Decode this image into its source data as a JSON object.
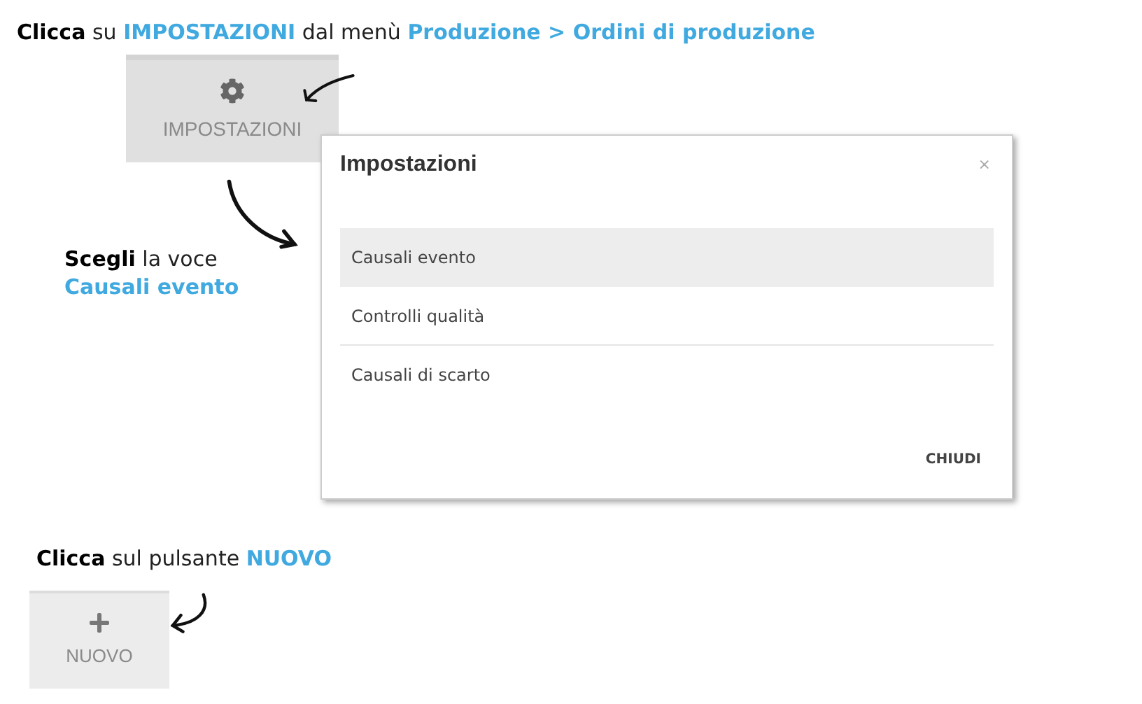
{
  "instructions": [
    {
      "lines": [
        [
          {
            "text": "Clicca",
            "kind": "strong"
          },
          {
            "text": " su ",
            "kind": "plain"
          },
          {
            "text": "IMPOSTAZIONI",
            "kind": "highlight"
          },
          {
            "text": " dal menù ",
            "kind": "plain"
          },
          {
            "text": "Produzione > Ordini di produzione",
            "kind": "highlight"
          }
        ]
      ]
    },
    {
      "lines": [
        [
          {
            "text": "Scegli",
            "kind": "strong"
          },
          {
            "text": " la voce",
            "kind": "plain"
          }
        ],
        [
          {
            "text": "Causali evento",
            "kind": "highlight"
          }
        ]
      ]
    },
    {
      "lines": [
        [
          {
            "text": "Clicca",
            "kind": "strong"
          },
          {
            "text": " sul pulsante ",
            "kind": "plain"
          },
          {
            "text": "NUOVO",
            "kind": "highlight"
          }
        ]
      ]
    }
  ],
  "settings_button": {
    "label": "IMPOSTAZIONI"
  },
  "dialog": {
    "title": "Impostazioni",
    "close": "×",
    "items": [
      {
        "label": "Causali evento",
        "selected": true
      },
      {
        "label": "Controlli qualità",
        "selected": false
      },
      {
        "label": "Causali di scarto",
        "selected": false
      }
    ],
    "action": "CHIUDI"
  },
  "new_button": {
    "label": "NUOVO"
  }
}
